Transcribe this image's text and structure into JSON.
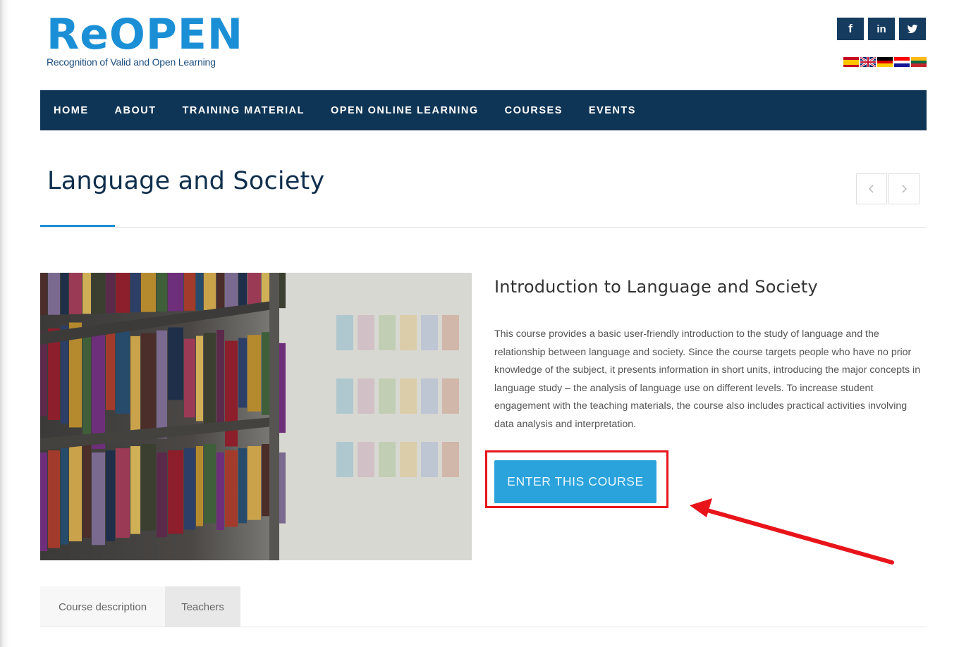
{
  "logo": {
    "title": "ReOPEN",
    "subtitle": "Recognition of Valid and Open Learning"
  },
  "social": [
    {
      "name": "facebook",
      "glyph": "f"
    },
    {
      "name": "linkedin",
      "glyph": "in"
    },
    {
      "name": "twitter",
      "icon": "twitter-bird-icon"
    }
  ],
  "languages": [
    "Spanish",
    "English",
    "German",
    "Croatian",
    "Lithuanian"
  ],
  "nav": {
    "items": [
      "HOME",
      "ABOUT",
      "TRAINING MATERIAL",
      "OPEN ONLINE LEARNING",
      "COURSES",
      "EVENTS"
    ]
  },
  "page": {
    "title": "Language and Society"
  },
  "course": {
    "title": "Introduction to Language and Society",
    "description": "This course provides a basic user-friendly introduction to the study of language and the relationship between language and society. Since the course targets people who have no prior knowledge of the subject, it presents information in short units, introducing the major concepts in language study – the analysis of language use on different levels. To increase student engagement with the teaching materials, the course also includes practical activities involving data analysis and interpretation.",
    "enter_label": "ENTER THIS COURSE"
  },
  "tabs": [
    "Course description",
    "Teachers"
  ],
  "colors": {
    "brand_blue": "#1b8fd6",
    "nav_navy": "#0f3556",
    "button_blue": "#2aa3dc",
    "annotation_red": "#e8141a"
  }
}
